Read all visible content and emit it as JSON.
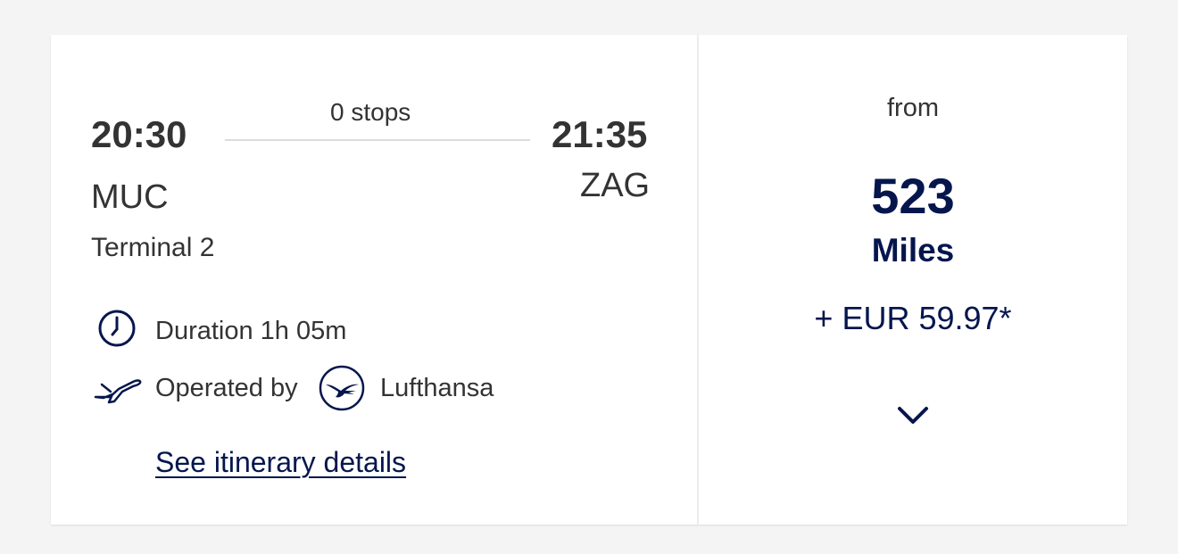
{
  "flight": {
    "departure_time": "20:30",
    "arrival_time": "21:35",
    "stops": "0 stops",
    "origin": "MUC",
    "destination": "ZAG",
    "origin_terminal": "Terminal 2",
    "duration": "Duration 1h 05m",
    "operated_by_label": "Operated by",
    "carrier": "Lufthansa",
    "details_link": "See itinerary details"
  },
  "fare": {
    "from_label": "from",
    "miles": "523",
    "miles_unit": "Miles",
    "surcharge": "+ EUR 59.97*"
  },
  "icons": {
    "duration": "clock-icon",
    "operator": "airplane-icon",
    "airline_logo": "lufthansa-crane-logo",
    "expand": "chevron-down-icon"
  },
  "colors": {
    "brand_navy": "#05164d",
    "text": "#333333",
    "background": "#f4f4f4",
    "card": "#ffffff"
  }
}
